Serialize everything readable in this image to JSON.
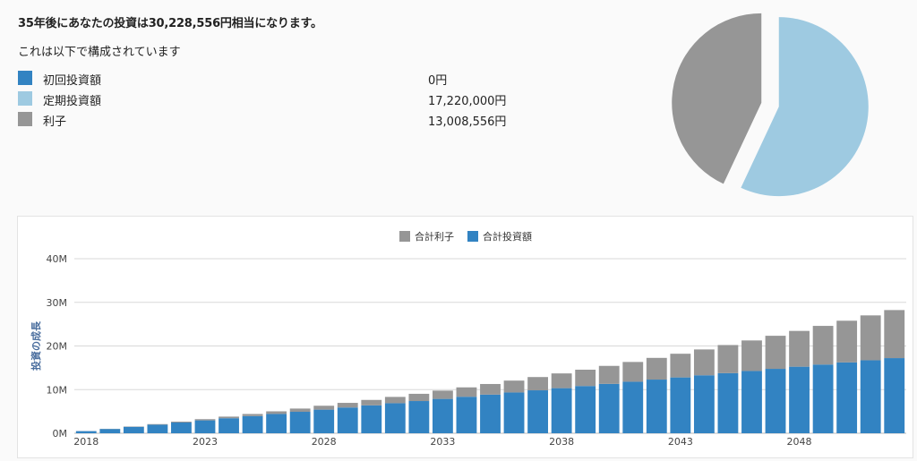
{
  "summary": {
    "title": "35年後にあなたの投資は30,228,556円相当になります。",
    "breakdown_heading": "これは以下で構成されています",
    "items": [
      {
        "label": "初回投資額",
        "value": "0円",
        "color": "#3283c2"
      },
      {
        "label": "定期投資額",
        "value": "17,220,000円",
        "color": "#9ecae1"
      },
      {
        "label": "利子",
        "value": "13,008,556円",
        "color": "#969696"
      }
    ]
  },
  "pie_chart": {
    "type": "pie",
    "slices": [
      {
        "name": "初回投資額",
        "value": 0,
        "color": "#3283c2"
      },
      {
        "name": "定期投資額",
        "value": 17220000,
        "color": "#9ecae1"
      },
      {
        "name": "利子",
        "value": 13008556,
        "color": "#969696"
      }
    ]
  },
  "chart_data": {
    "type": "bar",
    "stacked": true,
    "legend": [
      "合計利子",
      "合計投資額"
    ],
    "ylabel": "投資の成長",
    "ylim": [
      0,
      40000000
    ],
    "yticks": [
      "0M",
      "10M",
      "20M",
      "30M",
      "40M"
    ],
    "xticks": [
      "2018",
      "2023",
      "2028",
      "2033",
      "2038",
      "2043",
      "2048"
    ],
    "categories": [
      2018,
      2019,
      2020,
      2021,
      2022,
      2023,
      2024,
      2025,
      2026,
      2027,
      2028,
      2029,
      2030,
      2031,
      2032,
      2033,
      2034,
      2035,
      2036,
      2037,
      2038,
      2039,
      2040,
      2041,
      2042,
      2043,
      2044,
      2045,
      2046,
      2047,
      2048,
      2049,
      2050,
      2051,
      2052
    ],
    "series": [
      {
        "name": "合計投資額",
        "color": "#3283c2",
        "values": [
          492000,
          984000,
          1476000,
          1968000,
          2460000,
          2952000,
          3444000,
          3936000,
          4428000,
          4920000,
          5412000,
          5904000,
          6396000,
          6888000,
          7380000,
          7872000,
          8364000,
          8856000,
          9348000,
          9840000,
          10332000,
          10824000,
          11316000,
          11808000,
          12300000,
          12792000,
          13284000,
          13776000,
          14268000,
          14760000,
          15252000,
          15744000,
          16236000,
          16728000,
          17220000
        ]
      },
      {
        "name": "合計利子",
        "color": "#969696",
        "values": [
          10000,
          40000,
          80000,
          130000,
          200000,
          280000,
          370000,
          480000,
          600000,
          740000,
          890000,
          1060000,
          1240000,
          1440000,
          1660000,
          1900000,
          2150000,
          2430000,
          2720000,
          3040000,
          3380000,
          3740000,
          4120000,
          4530000,
          4970000,
          5430000,
          5920000,
          6440000,
          7000000,
          7580000,
          8200000,
          8860000,
          9550000,
          10280000,
          11008556
        ]
      }
    ]
  }
}
